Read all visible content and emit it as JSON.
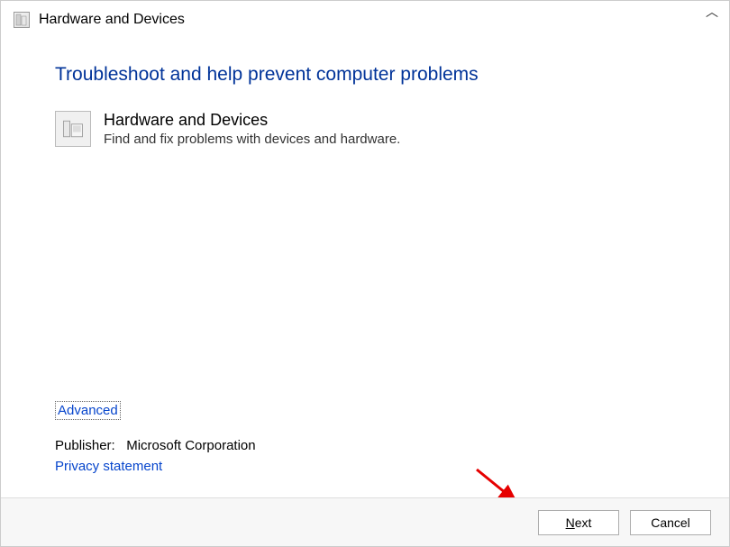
{
  "titlebar": {
    "title": "Hardware and Devices"
  },
  "content": {
    "heading": "Troubleshoot and help prevent computer problems",
    "item": {
      "title": "Hardware and Devices",
      "description": "Find and fix problems with devices and hardware."
    }
  },
  "links": {
    "advanced": "Advanced",
    "publisher_label": "Publisher:",
    "publisher_value": "Microsoft Corporation",
    "privacy": "Privacy statement"
  },
  "footer": {
    "next_prefix": "N",
    "next_suffix": "ext",
    "cancel": "Cancel"
  }
}
